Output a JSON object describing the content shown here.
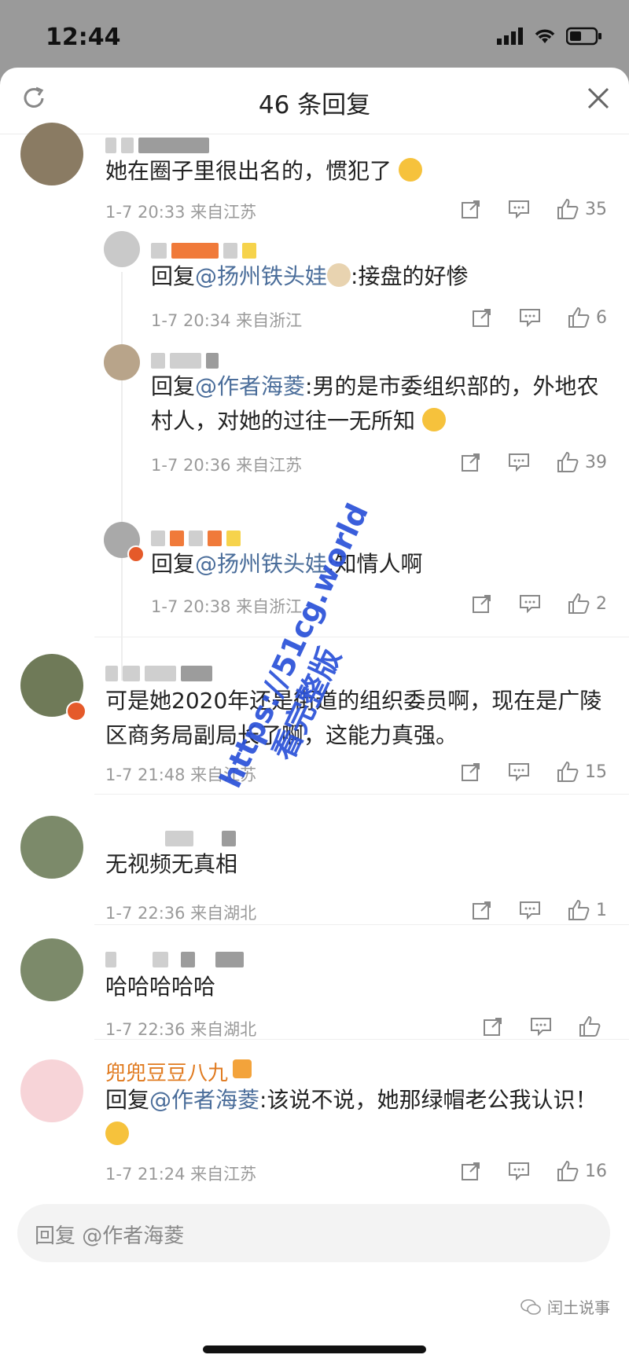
{
  "status_bar": {
    "time": "12:44"
  },
  "sheet": {
    "title": "46 条回复"
  },
  "comments": [
    {
      "text": "她在圈子里很出名的，惯犯了",
      "meta": "1-7 20:33  来自江苏",
      "likes": "35"
    },
    {
      "prefix": "回复",
      "mention": "@扬州铁头娃",
      "text": ":接盘的好惨",
      "meta": "1-7 20:34  来自浙江",
      "likes": "6"
    },
    {
      "prefix": "回复",
      "mention": "@作者海菱",
      "text": ":男的是市委组织部的，外地农村人，对她的过往一无所知",
      "meta": "1-7 20:36  来自江苏",
      "likes": "39"
    },
    {
      "prefix": "回复",
      "mention": "@扬州铁头娃",
      "text": ":知情人啊",
      "meta": "1-7 20:38  来自浙江",
      "likes": "2"
    },
    {
      "text": "可是她2020年还是街道的组织委员啊，现在是广陵区商务局副局长了啊，这能力真强。",
      "meta": "1-7 21:48  来自江苏",
      "likes": "15"
    },
    {
      "text": "无视频无真相",
      "meta": "1-7 22:36  来自湖北",
      "likes": "1"
    },
    {
      "text": "哈哈哈哈哈",
      "meta": "1-7 22:36  来自湖北",
      "likes": ""
    },
    {
      "username": "兜兜豆豆八九",
      "prefix": "回复",
      "mention": "@作者海菱",
      "text": ":该说不说，她那绿帽老公我认识！",
      "meta": "1-7 21:24  来自江苏",
      "likes": "16"
    }
  ],
  "reply_bar": {
    "placeholder": "回复 @作者海菱"
  },
  "footer": {
    "brand": "闰土说事"
  },
  "watermark": {
    "line1": "https://51cg.world",
    "line2": "看完整版"
  },
  "colors": {
    "mention": "#4a6d9a",
    "meta": "#9a9a9a",
    "watermark": "#2a51d8"
  }
}
